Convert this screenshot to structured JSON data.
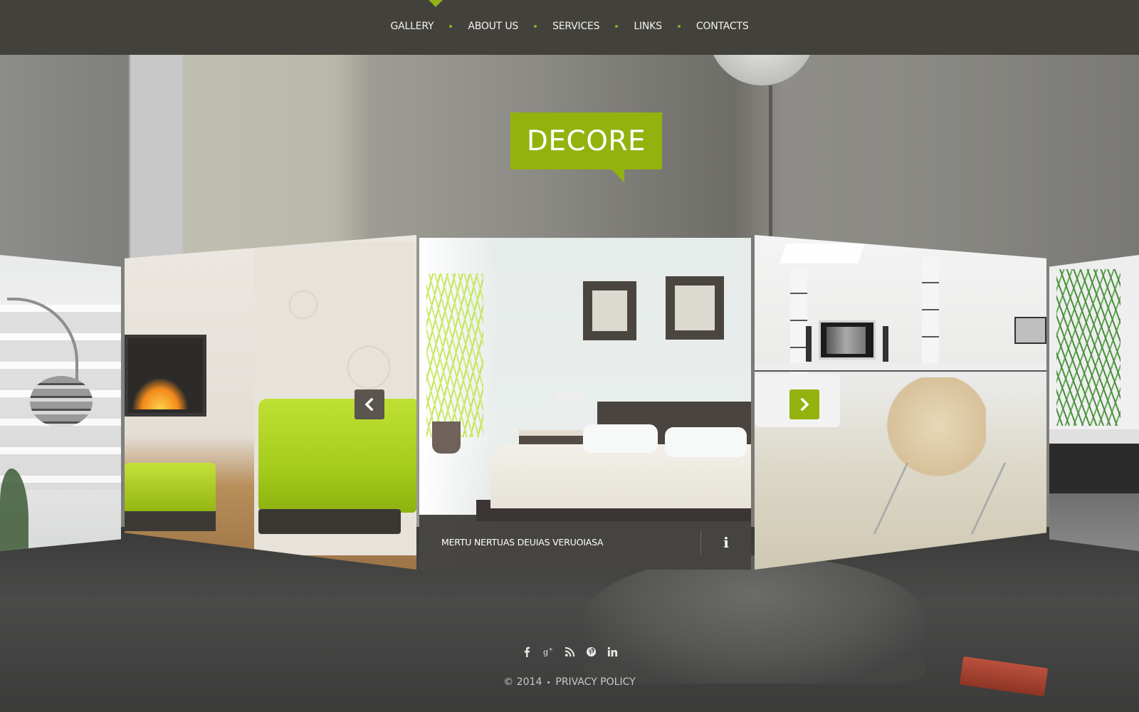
{
  "nav": {
    "items": [
      {
        "label": "Gallery",
        "active": true
      },
      {
        "label": "About Us"
      },
      {
        "label": "Services"
      },
      {
        "label": "Links"
      },
      {
        "label": "Contacts"
      }
    ]
  },
  "logo": {
    "text": "DECORE"
  },
  "carousel": {
    "slides": [
      {
        "description": "Living room with arc lamp and staircase"
      },
      {
        "description": "Lime green armchair with fireplace"
      },
      {
        "description": "Bedroom with wall frames",
        "caption": "MERTU NERTUAS DEUIAS VERUOIASA",
        "active": true
      },
      {
        "description": "White living room with lounge chair"
      },
      {
        "description": "Room with palm plant and dark sofa"
      }
    ],
    "info_label": "i",
    "prev_icon": "chevron-left-icon",
    "next_icon": "chevron-right-icon"
  },
  "social": [
    {
      "name": "facebook"
    },
    {
      "name": "google-plus"
    },
    {
      "name": "rss"
    },
    {
      "name": "pinterest"
    },
    {
      "name": "linkedin"
    }
  ],
  "footer": {
    "copyright": "© 2014",
    "privacy": "Privacy Policy"
  },
  "colors": {
    "accent": "#93b20e",
    "header_bg": "#43413c",
    "caption_bg": "#383633",
    "prev_button": "#5a554e"
  }
}
